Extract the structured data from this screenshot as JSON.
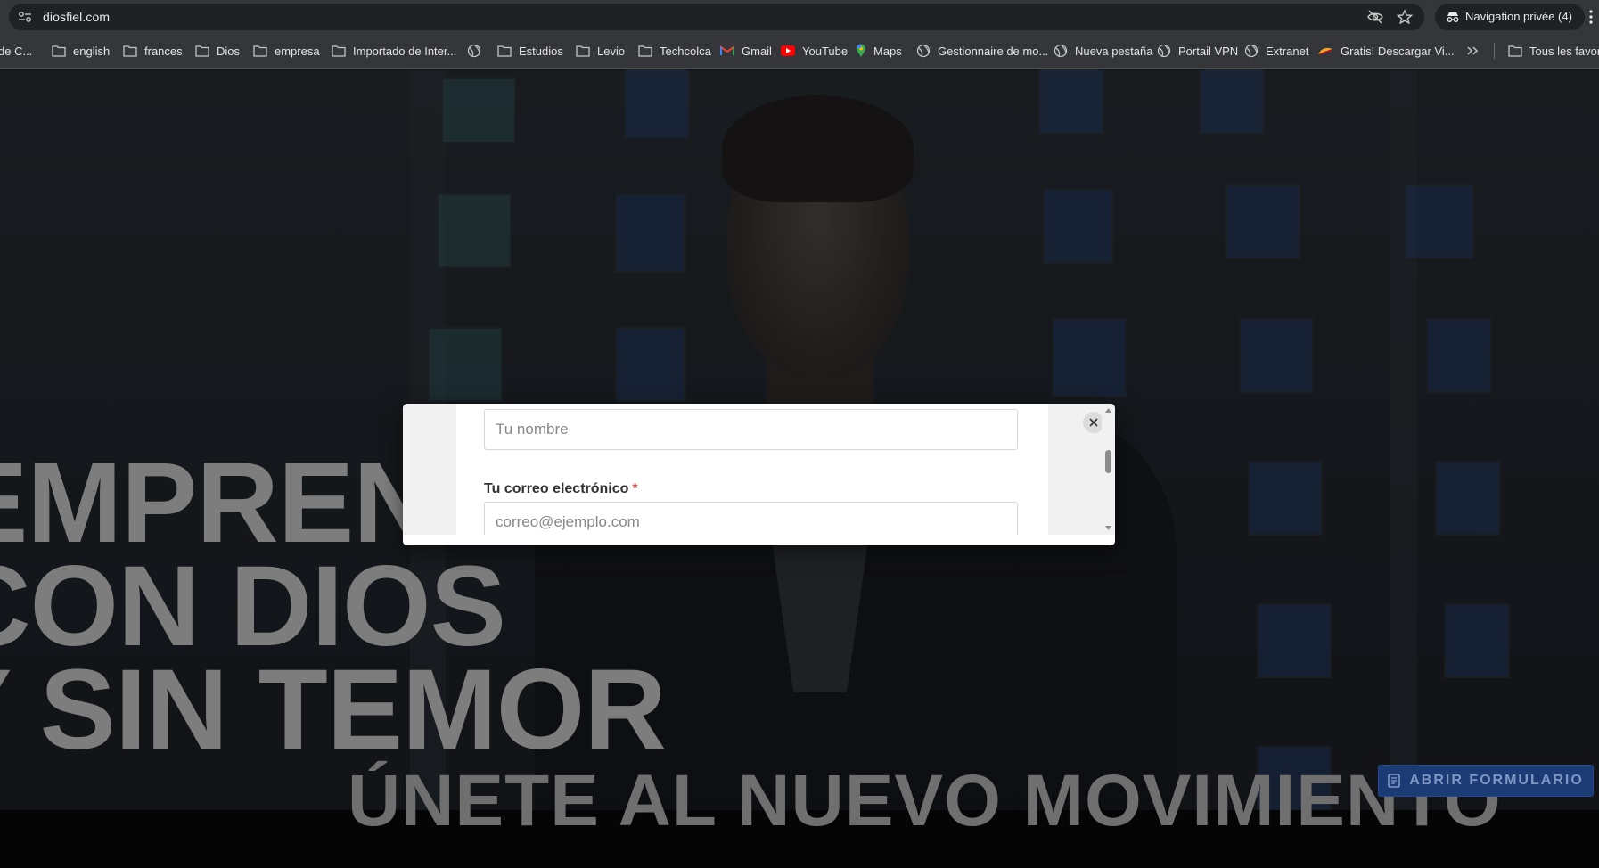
{
  "browser": {
    "url": "diosfiel.com",
    "incognito_label": "Navigation privée (4)",
    "icons": [
      "site-info-icon",
      "eye-off-icon",
      "star-icon",
      "incognito-icon",
      "more-vert-icon"
    ]
  },
  "bookmarks": [
    {
      "label": "de C...",
      "icon": "folder-icon"
    },
    {
      "label": "english",
      "icon": "folder-icon"
    },
    {
      "label": "frances",
      "icon": "folder-icon"
    },
    {
      "label": "Dios",
      "icon": "folder-icon"
    },
    {
      "label": "empresa",
      "icon": "folder-icon"
    },
    {
      "label": "Importado de Inter...",
      "icon": "folder-icon"
    },
    {
      "label": "",
      "icon": "globe-icon"
    },
    {
      "label": "Estudios",
      "icon": "folder-icon"
    },
    {
      "label": "Levio",
      "icon": "folder-icon"
    },
    {
      "label": "Techcolca",
      "icon": "folder-icon"
    },
    {
      "label": "Gmail",
      "icon": "gmail-icon"
    },
    {
      "label": "YouTube",
      "icon": "youtube-icon"
    },
    {
      "label": "Maps",
      "icon": "maps-icon"
    },
    {
      "label": "Gestionnaire de mo...",
      "icon": "globe-icon"
    },
    {
      "label": "Nueva pestaña",
      "icon": "globe-icon"
    },
    {
      "label": "Portail VPN",
      "icon": "globe-icon"
    },
    {
      "label": "Extranet",
      "icon": "globe-icon"
    },
    {
      "label": "Gratis! Descargar Vi...",
      "icon": "bookmark-favicon-icon"
    },
    {
      "label": "Tous les favoris",
      "icon": "folder-icon"
    }
  ],
  "hero": {
    "line1": "EMPRENDE",
    "line2": "CON DIOS",
    "line3": "Y SIN TEMOR"
  },
  "band": {
    "title": "ÚNETE AL NUEVO MOVIMIENTO",
    "open_form_button": "ABRIR FORMULARIO"
  },
  "modal": {
    "name_placeholder": "Tu nombre",
    "email_label": "Tu correo electrónico",
    "required_mark": "*",
    "email_placeholder": "correo@ejemplo.com"
  },
  "colors": {
    "accent_button": "#1c3a73",
    "required": "#d9534f"
  }
}
